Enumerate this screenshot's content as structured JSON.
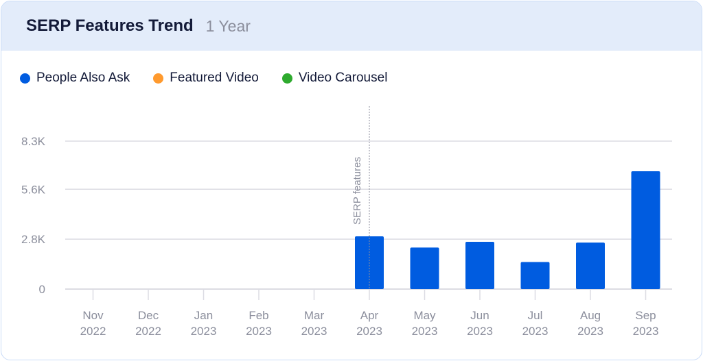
{
  "header": {
    "title": "SERP Features Trend",
    "period": "1 Year"
  },
  "legend": [
    {
      "label": "People Also Ask",
      "color": "#005ce0"
    },
    {
      "label": "Featured Video",
      "color": "#ff9a2e"
    },
    {
      "label": "Video Carousel",
      "color": "#2eaa2e"
    }
  ],
  "chart_data": {
    "type": "bar",
    "title": "SERP Features Trend",
    "xlabel": "",
    "ylabel": "",
    "ylim": [
      0,
      8300
    ],
    "yticks": [
      0,
      2800,
      5600,
      8300
    ],
    "ytick_labels": [
      "0",
      "2.8K",
      "5.6K",
      "8.3K"
    ],
    "grid": true,
    "legend_position": "top-left",
    "categories": [
      {
        "month": "Nov",
        "year": "2022"
      },
      {
        "month": "Dec",
        "year": "2022"
      },
      {
        "month": "Jan",
        "year": "2023"
      },
      {
        "month": "Feb",
        "year": "2023"
      },
      {
        "month": "Mar",
        "year": "2023"
      },
      {
        "month": "Apr",
        "year": "2023"
      },
      {
        "month": "May",
        "year": "2023"
      },
      {
        "month": "Jun",
        "year": "2023"
      },
      {
        "month": "Jul",
        "year": "2023"
      },
      {
        "month": "Aug",
        "year": "2023"
      },
      {
        "month": "Sep",
        "year": "2023"
      }
    ],
    "series": [
      {
        "name": "People Also Ask",
        "color": "#005ce0",
        "values": [
          0,
          0,
          0,
          0,
          0,
          2960,
          2330,
          2650,
          1520,
          2610,
          6610
        ]
      },
      {
        "name": "Featured Video",
        "color": "#ff9a2e",
        "values": [
          0,
          0,
          0,
          0,
          0,
          0,
          0,
          0,
          0,
          0,
          0
        ]
      },
      {
        "name": "Video Carousel",
        "color": "#2eaa2e",
        "values": [
          0,
          0,
          0,
          0,
          0,
          0,
          0,
          0,
          0,
          0,
          0
        ]
      }
    ],
    "annotations": [
      {
        "category_index": 5,
        "label": "SERP features",
        "style": "dotted-vertical-line"
      }
    ]
  }
}
